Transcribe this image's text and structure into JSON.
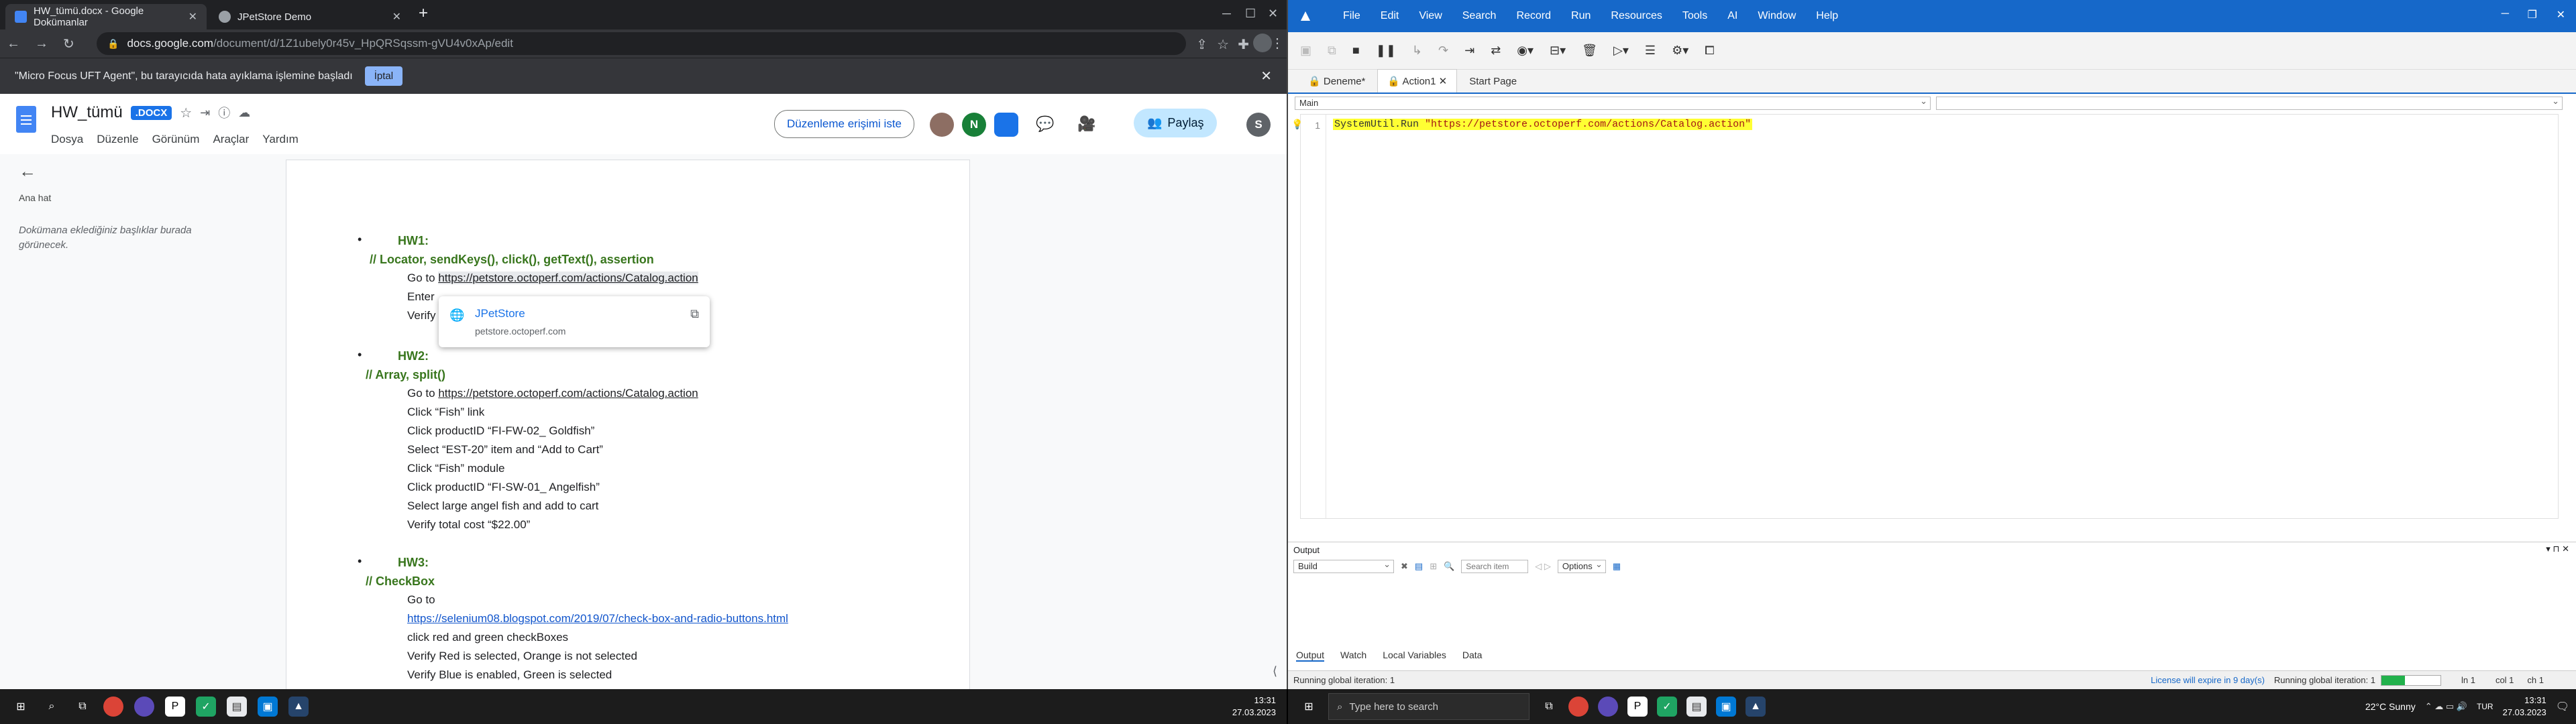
{
  "chrome": {
    "tabs": [
      {
        "title": "HW_tümü.docx - Google Dokümanlar",
        "active": true
      },
      {
        "title": "JPetStore Demo",
        "active": false
      }
    ],
    "new_tab": "+",
    "url_domain": "docs.google.com",
    "url_path": "/document/d/1Z1ubely0r45v_HpQRSqssm-gVU4v0xAp/edit",
    "infobar_text": "\"Micro Focus UFT Agent\", bu tarayıcıda hata ayıklama işlemine başladı",
    "infobar_button": "İptal"
  },
  "docs": {
    "title": "HW_tümü",
    "badge": ".DOCX",
    "menus": [
      "Dosya",
      "Düzenle",
      "Görünüm",
      "Araçlar",
      "Yardım"
    ],
    "request_edit": "Düzenleme erişimi iste",
    "share": "Paylaş",
    "avatars": [
      "N",
      "S"
    ],
    "outline_title": "Ana hat",
    "outline_hint": "Dokümana eklediğiniz başlıklar burada görünecek.",
    "popup": {
      "title": "JPetStore",
      "domain": "petstore.octoperf.com"
    },
    "content": {
      "hw1": "HW1:",
      "hw1_sub": "// Locator, sendKeys(), click(), getText(), assertion",
      "hw1_goto": "Go to ",
      "hw1_link": "https://petstore.octoperf.com/actions/Catalog.action",
      "hw1_l2": "Enter",
      "hw1_l3": "Verify",
      "hw2": "HW2:",
      "hw2_sub": "// Array, split()",
      "hw2_goto": "Go to ",
      "hw2_link": "https://petstore.octoperf.com/actions/Catalog.action",
      "hw2_lines": [
        "Click “Fish” link",
        "Click productID “FI-FW-02_ Goldfish”",
        "Select “EST-20” item and “Add to Cart”",
        "Click “Fish” module",
        "Click productID “FI-SW-01_ Angelfish”",
        "Select large angel fish and add to cart",
        "Verify total cost “$22.00”"
      ],
      "hw3": "HW3:",
      "hw3_sub": "// CheckBox",
      "hw3_goto": "Go to",
      "hw3_link": "https://selenium08.blogspot.com/2019/07/check-box-and-radio-buttons.html",
      "hw3_lines": [
        "click red and green checkBoxes",
        "Verify Red is selected, Orange is not selected",
        "Verify Blue is enabled, Green is selected"
      ]
    }
  },
  "uft": {
    "menus": [
      "File",
      "Edit",
      "View",
      "Search",
      "Record",
      "Run",
      "Resources",
      "Tools",
      "AI",
      "Window",
      "Help"
    ],
    "tabs": [
      "Deneme*",
      "Action1",
      "Start Page"
    ],
    "scope_select": "Main",
    "line_number": "1",
    "code_prefix": "SystemUtil.Run ",
    "code_string": "\"https://petstore.octoperf.com/actions/Catalog.action\"",
    "output_label": "Output",
    "output_select": "Build",
    "output_search_placeholder": "Search item",
    "output_options": "Options",
    "bottom_tabs": [
      "Output",
      "Watch",
      "Local Variables",
      "Data"
    ],
    "status_left": "Running global iteration: 1",
    "license": "License will expire in 9 day(s)",
    "status_iter": "Running global iteration: 1",
    "ln": "ln 1",
    "col": "col 1",
    "ch": "ch 1"
  },
  "taskbar": {
    "left_time": "13:31",
    "left_date": "27.03.2023",
    "search_placeholder": "Type here to search",
    "weather": "22°C  Sunny",
    "lang": "TUR",
    "right_time": "13:31",
    "right_date": "27.03.2023"
  },
  "colors": {
    "uft_blue": "#1668c9",
    "docs_blue": "#1a73e8",
    "hw_green": "#38761d",
    "link_blue": "#1155cc"
  }
}
